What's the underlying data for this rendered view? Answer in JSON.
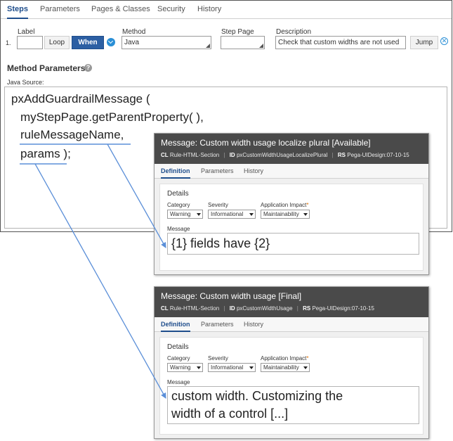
{
  "rule_form": {
    "tabs": [
      {
        "label": "Steps"
      },
      {
        "label": "Parameters"
      },
      {
        "label": "Pages & Classes"
      },
      {
        "label": "Security"
      },
      {
        "label": "History"
      }
    ],
    "step_row": {
      "number": "1.",
      "label_caption": "Label",
      "label_value": "",
      "loop_label": "Loop",
      "when_label": "When",
      "method_caption": "Method",
      "method_value": "Java",
      "step_page_caption": "Step Page",
      "step_page_value": "",
      "description_caption": "Description",
      "description_value": "Check that custom widths are not used",
      "jump_label": "Jump"
    },
    "method_parameters_heading": "Method Parameters",
    "java_source_caption": "Java Source:",
    "code_lines": [
      "pxAddGuardrailMessage  (",
      "myStepPage.getParentProperty(  ),",
      "ruleMessageName,",
      "params );"
    ]
  },
  "popups": [
    {
      "title": "Message: Custom width usage localize plural [Available]",
      "class_tag": "CL",
      "class_value": "Rule-HTML-Section",
      "id_tag": "ID",
      "id_value": "pxCustomWidthUsageLocalizePlural",
      "ruleset_tag": "RS",
      "ruleset_value": "Pega-UIDesign:07-10-15",
      "tabs": [
        "Definition",
        "Parameters",
        "History"
      ],
      "details_heading": "Details",
      "category_caption": "Category",
      "category_value": "Warning",
      "severity_caption": "Severity",
      "severity_value": "Informational",
      "impact_caption": "Application Impact",
      "impact_required_mark": "*",
      "impact_value": "Maintainability",
      "message_caption": "Message",
      "message_value": "{1} fields have {2}"
    },
    {
      "title": "Message: Custom width usage [Final]",
      "class_tag": "CL",
      "class_value": "Rule-HTML-Section",
      "id_tag": "ID",
      "id_value": "pxCustomWidthUsage",
      "ruleset_tag": "RS",
      "ruleset_value": "Pega-UIDesign:07-10-15",
      "tabs": [
        "Definition",
        "Parameters",
        "History"
      ],
      "details_heading": "Details",
      "category_caption": "Category",
      "category_value": "Warning",
      "severity_caption": "Severity",
      "severity_value": "Informational",
      "impact_caption": "Application Impact",
      "impact_required_mark": "*",
      "impact_value": "Maintainability",
      "message_caption": "Message",
      "message_lines": [
        "custom width. Customizing the",
        "width of a control [...]"
      ]
    }
  ],
  "icons": {
    "when_expand": "chevron-down-circle-icon",
    "remove_step": "close-circle-icon",
    "help": "help-icon",
    "remove_glyph": "✕",
    "help_glyph": "?"
  },
  "colors": {
    "accent_blue": "#2c5fa3",
    "active_tab": "#1f4e8c",
    "popup_header": "#4a4a4a",
    "connector_line": "#5b8fd8"
  }
}
